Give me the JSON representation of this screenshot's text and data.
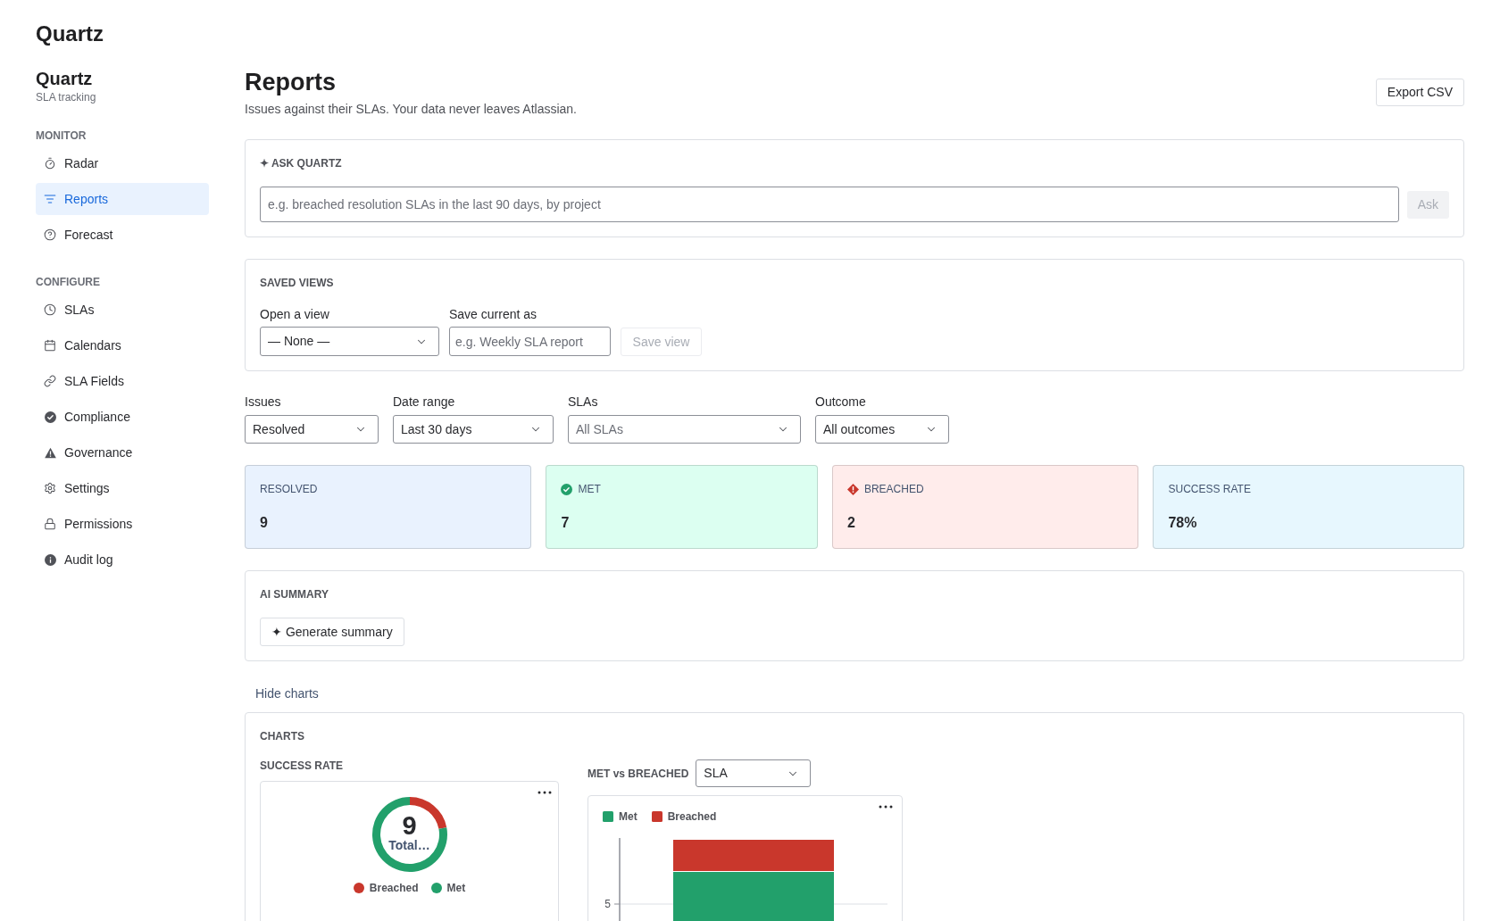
{
  "app": {
    "title": "Quartz"
  },
  "sidebar": {
    "title": "Quartz",
    "subtitle": "SLA tracking",
    "sections": [
      {
        "heading": "MONITOR",
        "items": [
          {
            "label": "Radar",
            "selected": false
          },
          {
            "label": "Reports",
            "selected": true
          },
          {
            "label": "Forecast",
            "selected": false
          }
        ]
      },
      {
        "heading": "CONFIGURE",
        "items": [
          {
            "label": "SLAs",
            "selected": false
          },
          {
            "label": "Calendars",
            "selected": false
          },
          {
            "label": "SLA Fields",
            "selected": false
          },
          {
            "label": "Compliance",
            "selected": false
          },
          {
            "label": "Governance",
            "selected": false
          },
          {
            "label": "Settings",
            "selected": false
          },
          {
            "label": "Permissions",
            "selected": false
          },
          {
            "label": "Audit log",
            "selected": false
          }
        ]
      }
    ]
  },
  "page": {
    "title": "Reports",
    "subtitle": "Issues against their SLAs. Your data never leaves Atlassian.",
    "export_button": "Export CSV"
  },
  "ask_quartz": {
    "heading": "✦ ASK QUARTZ",
    "input": {
      "placeholder": "e.g. breached resolution SLAs in the last 90 days, by project"
    },
    "button": {
      "label": "Ask",
      "disabled": true
    }
  },
  "saved_views": {
    "heading": "SAVED VIEWS",
    "open_view": {
      "label": "Open a view",
      "value": "— None —"
    },
    "save_as": {
      "label": "Save current as",
      "placeholder": "e.g. Weekly SLA report"
    },
    "save_button": {
      "label": "Save view",
      "disabled": true
    }
  },
  "filters": [
    {
      "label": "Issues",
      "value": "Resolved"
    },
    {
      "label": "Date range",
      "value": "Last 30 days"
    },
    {
      "label": "SLAs",
      "placeholder": "All SLAs"
    },
    {
      "label": "Outcome",
      "value": "All outcomes"
    }
  ],
  "stats": [
    {
      "label": "RESOLVED",
      "value": "9",
      "kind": "plain",
      "color": "#e9f2fe"
    },
    {
      "label": "MET",
      "value": "7",
      "kind": "success",
      "color": "#dcfff1"
    },
    {
      "label": "BREACHED",
      "value": "2",
      "kind": "danger",
      "color": "#ffeceb"
    },
    {
      "label": "SUCCESS RATE",
      "value": "78%",
      "kind": "plain",
      "color": "#e7f7fe"
    }
  ],
  "ai_summary": {
    "heading": "AI SUMMARY",
    "button": "✦ Generate summary"
  },
  "charts_toggle": "Hide charts",
  "charts": {
    "heading": "CHARTS",
    "success_rate": {
      "title": "SUCCESS RATE",
      "center_value": "9",
      "center_label": "Total…",
      "chart_data": {
        "type": "donut",
        "categories": [
          "Breached",
          "Met"
        ],
        "values": [
          22,
          78
        ],
        "colors": [
          "#c9372c",
          "#22a06b"
        ],
        "legend": "bottom"
      }
    },
    "met_vs_breached": {
      "title": "MET vs BREACHED",
      "group_by": {
        "value": "SLA"
      },
      "legend": [
        {
          "label": "Met",
          "color": "#22a06b"
        },
        {
          "label": "Breached",
          "color": "#c9372c"
        }
      ],
      "y_axis_labels": [
        "5"
      ]
    }
  }
}
